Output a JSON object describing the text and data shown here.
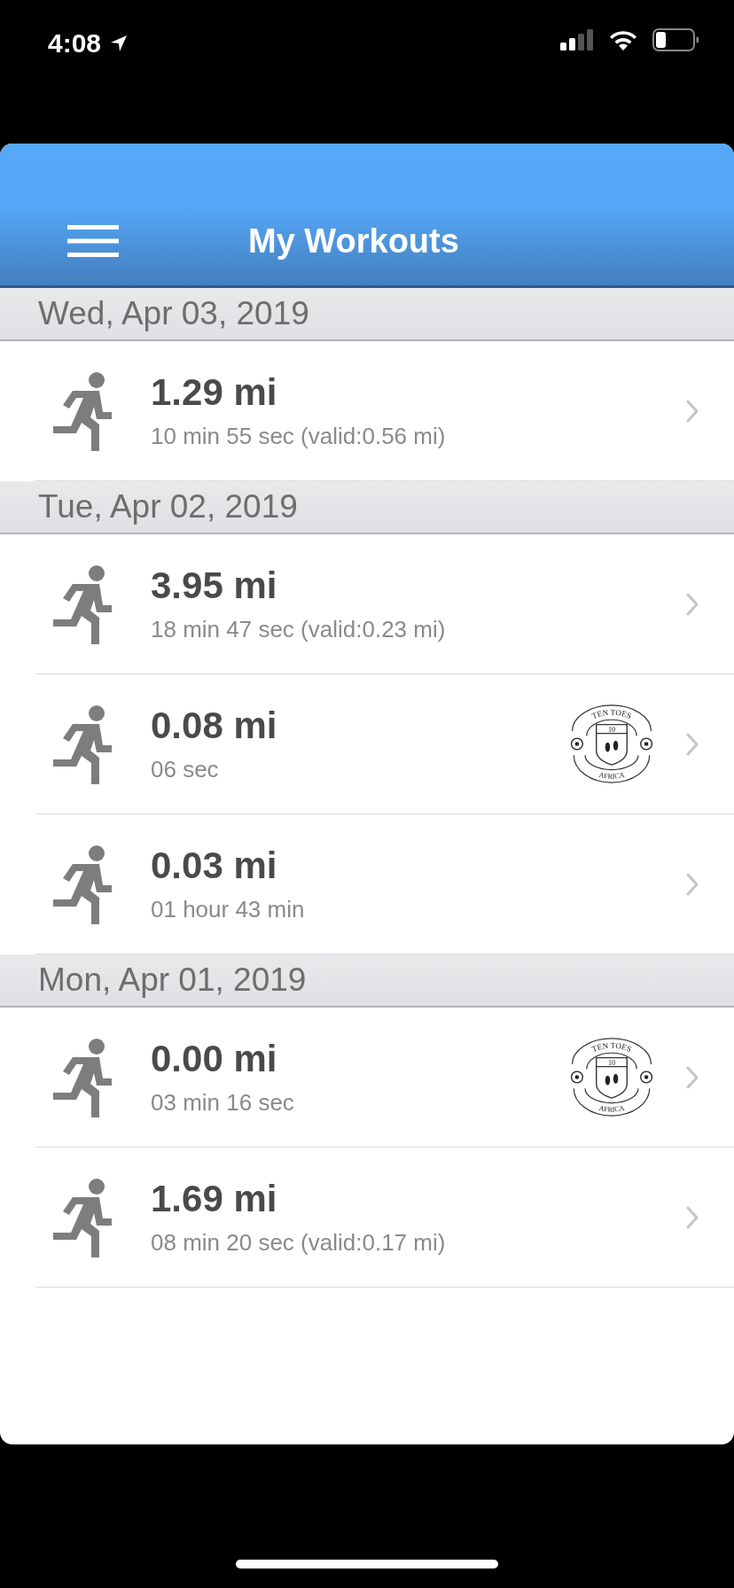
{
  "status_bar": {
    "time": "4:08"
  },
  "header": {
    "title": "My Workouts"
  },
  "days": [
    {
      "date": "Wed, Apr 03, 2019",
      "workouts": [
        {
          "distance": "1.29 mi",
          "detail": "10 min 55 sec (valid:0.56 mi)"
        }
      ]
    },
    {
      "date": "Tue, Apr 02, 2019",
      "workouts": [
        {
          "distance": "3.95 mi",
          "detail": "18 min 47 sec (valid:0.23 mi)"
        },
        {
          "distance": "0.08 mi",
          "detail": "06 sec",
          "badge": {
            "top": "TEN TOES",
            "number": "10",
            "bottom": "AFRICA"
          }
        },
        {
          "distance": "0.03 mi",
          "detail": "01 hour 43 min"
        }
      ]
    },
    {
      "date": "Mon, Apr 01, 2019",
      "workouts": [
        {
          "distance": "0.00 mi",
          "detail": "03 min 16 sec",
          "badge": {
            "top": "TEN TOES",
            "number": "10",
            "bottom": "AFRICA"
          }
        },
        {
          "distance": "1.69 mi",
          "detail": "08 min 20 sec (valid:0.17 mi)"
        }
      ]
    }
  ]
}
